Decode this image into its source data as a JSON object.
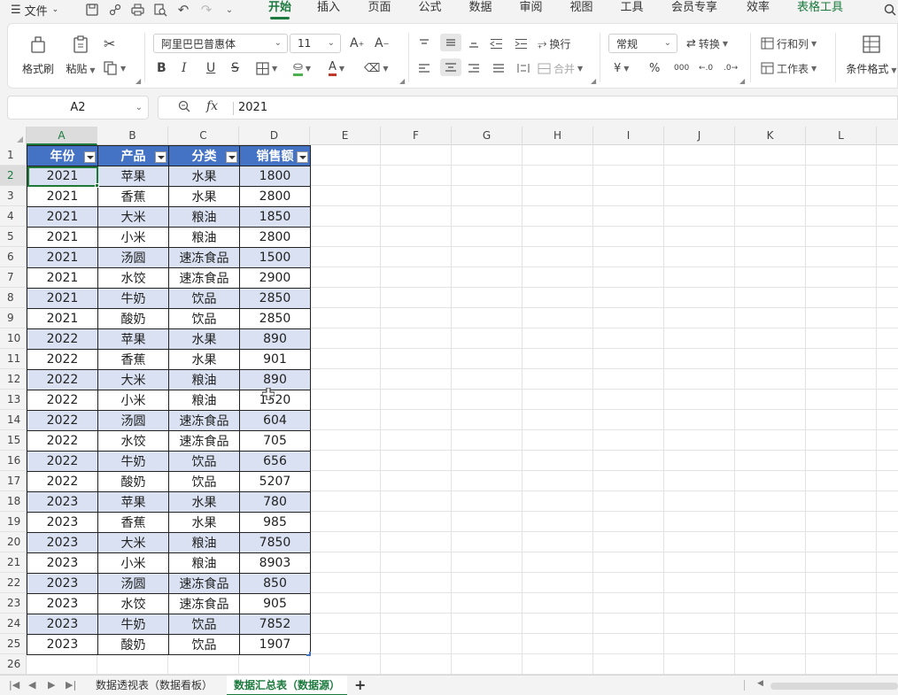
{
  "menubar": {
    "file_label": "文件",
    "tabs": [
      {
        "label": "开始",
        "width": 52,
        "active": true
      },
      {
        "label": "插入",
        "width": 58
      },
      {
        "label": "页面",
        "width": 57
      },
      {
        "label": "公式",
        "width": 57
      },
      {
        "label": "数据",
        "width": 57
      },
      {
        "label": "审阅",
        "width": 57
      },
      {
        "label": "视图",
        "width": 57
      },
      {
        "label": "工具",
        "width": 57
      },
      {
        "label": "会员专享",
        "width": 84
      },
      {
        "label": "效率",
        "width": 60
      },
      {
        "label": "表格工具",
        "width": 80,
        "tools": true
      }
    ]
  },
  "ribbon": {
    "format_painter": "格式刷",
    "paste": "粘贴",
    "font_name": "阿里巴巴普惠体",
    "font_size": "11",
    "wrap": "换行",
    "merge": "合并",
    "number_format": "常规",
    "convert": "转换",
    "row_col": "行和列",
    "worksheet": "工作表",
    "conditional_format": "条件格式",
    "currency_symbol": "¥",
    "percent_symbol": "%",
    "thousands_symbol": "000"
  },
  "formula": {
    "name_box": "A2",
    "fx": "fx",
    "value": "2021"
  },
  "columns": [
    "A",
    "B",
    "C",
    "D",
    "E",
    "F",
    "G",
    "H",
    "I",
    "J",
    "K",
    "L"
  ],
  "rows": [
    "1",
    "2",
    "3",
    "4",
    "5",
    "6",
    "7",
    "8",
    "9",
    "10",
    "11",
    "12",
    "13",
    "14",
    "15",
    "16",
    "17",
    "18",
    "19",
    "20",
    "21",
    "22",
    "23",
    "24",
    "25",
    "26"
  ],
  "table": {
    "headers": [
      "年份",
      "产品",
      "分类",
      "销售额"
    ],
    "rows": [
      [
        "2021",
        "苹果",
        "水果",
        "1800"
      ],
      [
        "2021",
        "香蕉",
        "水果",
        "2800"
      ],
      [
        "2021",
        "大米",
        "粮油",
        "1850"
      ],
      [
        "2021",
        "小米",
        "粮油",
        "2800"
      ],
      [
        "2021",
        "汤圆",
        "速冻食品",
        "1500"
      ],
      [
        "2021",
        "水饺",
        "速冻食品",
        "2900"
      ],
      [
        "2021",
        "牛奶",
        "饮品",
        "2850"
      ],
      [
        "2021",
        "酸奶",
        "饮品",
        "2850"
      ],
      [
        "2022",
        "苹果",
        "水果",
        "890"
      ],
      [
        "2022",
        "香蕉",
        "水果",
        "901"
      ],
      [
        "2022",
        "大米",
        "粮油",
        "890"
      ],
      [
        "2022",
        "小米",
        "粮油",
        "1520"
      ],
      [
        "2022",
        "汤圆",
        "速冻食品",
        "604"
      ],
      [
        "2022",
        "水饺",
        "速冻食品",
        "705"
      ],
      [
        "2022",
        "牛奶",
        "饮品",
        "656"
      ],
      [
        "2022",
        "酸奶",
        "饮品",
        "5207"
      ],
      [
        "2023",
        "苹果",
        "水果",
        "780"
      ],
      [
        "2023",
        "香蕉",
        "水果",
        "985"
      ],
      [
        "2023",
        "大米",
        "粮油",
        "7850"
      ],
      [
        "2023",
        "小米",
        "粮油",
        "8903"
      ],
      [
        "2023",
        "汤圆",
        "速冻食品",
        "850"
      ],
      [
        "2023",
        "水饺",
        "速冻食品",
        "905"
      ],
      [
        "2023",
        "牛奶",
        "饮品",
        "7852"
      ],
      [
        "2023",
        "酸奶",
        "饮品",
        "1907"
      ]
    ]
  },
  "sheets": [
    {
      "label": "数据透视表（数据看板）",
      "active": false
    },
    {
      "label": "数据汇总表（数据源）",
      "active": true
    }
  ],
  "colors": {
    "accent": "#1c7a3e",
    "header_blue": "#4472c4",
    "band_blue": "#d9e1f2"
  }
}
